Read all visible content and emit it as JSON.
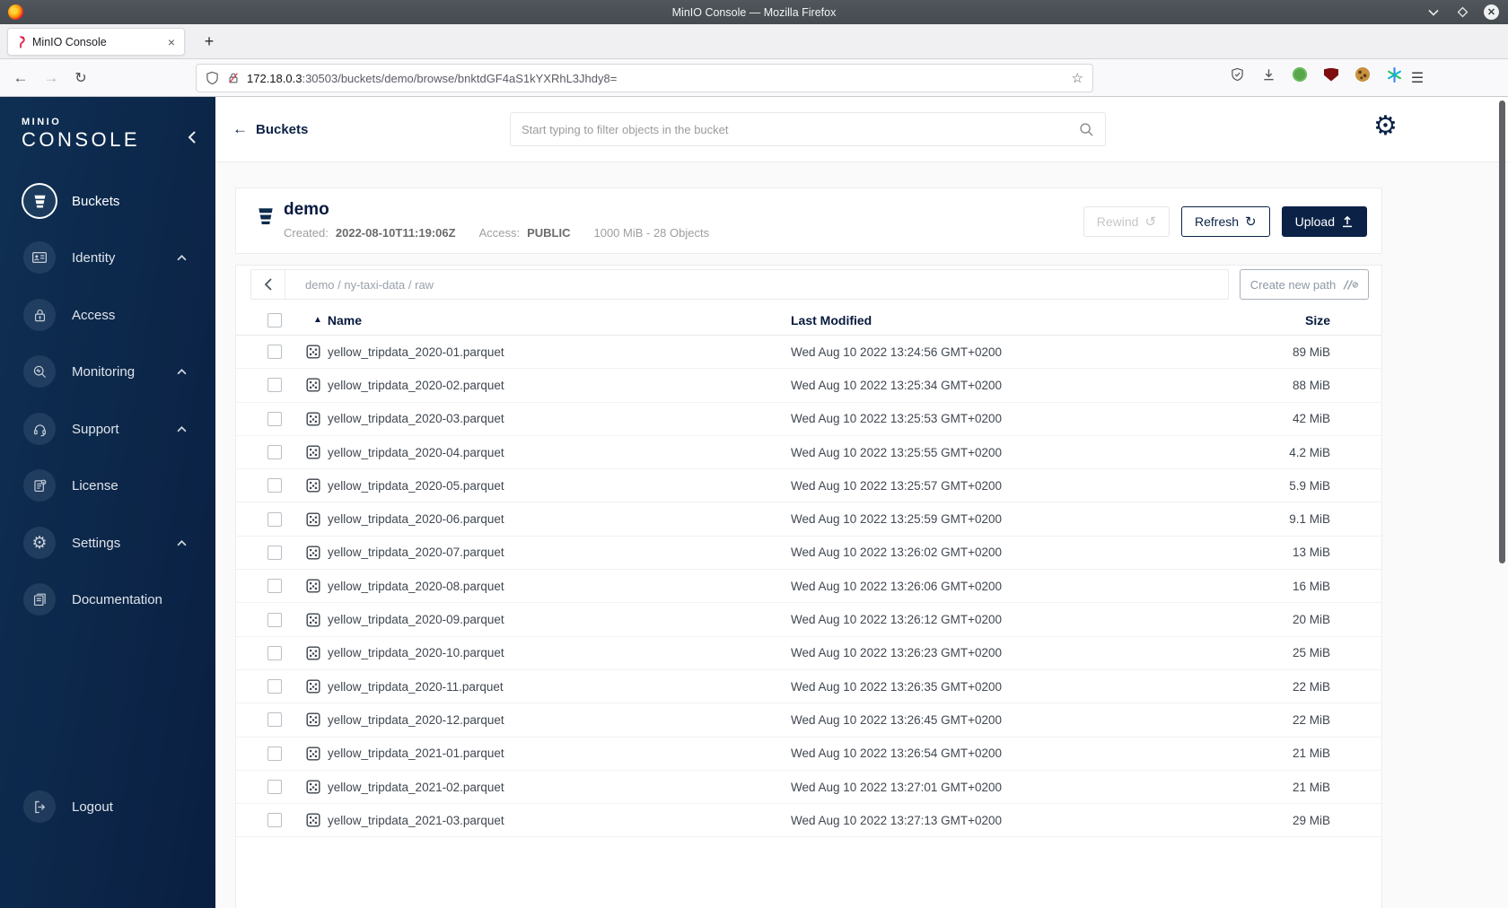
{
  "window": {
    "title": "MinIO Console — Mozilla Firefox",
    "minimize_glyph": "⌄",
    "close_glyph": "✕"
  },
  "tabbar": {
    "tab_title": "MinIO Console",
    "close_glyph": "×",
    "new_tab_glyph": "+"
  },
  "toolbar": {
    "back_glyph": "←",
    "forward_glyph": "→",
    "reload_glyph": "↻",
    "url_host": "172.18.0.3",
    "url_rest": ":30503/buckets/demo/browse/bnktdGF4aS1kYXRhL3Jhdy8=",
    "star_glyph": "☆",
    "menu_glyph": "☰"
  },
  "sidebar": {
    "logo_line1": "MINIO",
    "logo_line2": "CONSOLE",
    "items": [
      {
        "label": "Buckets",
        "active": true,
        "expandable": false
      },
      {
        "label": "Identity",
        "active": false,
        "expandable": true
      },
      {
        "label": "Access",
        "active": false,
        "expandable": false
      },
      {
        "label": "Monitoring",
        "active": false,
        "expandable": true
      },
      {
        "label": "Support",
        "active": false,
        "expandable": true
      },
      {
        "label": "License",
        "active": false,
        "expandable": false
      },
      {
        "label": "Settings",
        "active": false,
        "expandable": true
      },
      {
        "label": "Documentation",
        "active": false,
        "expandable": false
      }
    ],
    "settings_gear_glyph": "⚙",
    "logout_label": "Logout"
  },
  "page_header": {
    "back_glyph": "←",
    "back_label": "Buckets",
    "search_placeholder": "Start typing to filter objects in the bucket",
    "settings_gear_glyph": "⚙"
  },
  "bucket": {
    "name": "demo",
    "created_label": "Created:",
    "created_value": "2022-08-10T11:19:06Z",
    "access_label": "Access:",
    "access_value": "PUBLIC",
    "usage": "1000 MiB - 28 Objects",
    "rewind_label": "Rewind",
    "rewind_glyph": "↺",
    "refresh_label": "Refresh",
    "refresh_glyph": "↻",
    "upload_label": "Upload"
  },
  "browse": {
    "breadcrumb": "demo / ny-taxi-data / raw",
    "create_path_label": "Create new path"
  },
  "table": {
    "sort_glyph": "▲",
    "headers": {
      "name": "Name",
      "modified": "Last Modified",
      "size": "Size"
    },
    "rows": [
      {
        "name": "yellow_tripdata_2020-01.parquet",
        "modified": "Wed Aug 10 2022 13:24:56 GMT+0200",
        "size": "89 MiB"
      },
      {
        "name": "yellow_tripdata_2020-02.parquet",
        "modified": "Wed Aug 10 2022 13:25:34 GMT+0200",
        "size": "88 MiB"
      },
      {
        "name": "yellow_tripdata_2020-03.parquet",
        "modified": "Wed Aug 10 2022 13:25:53 GMT+0200",
        "size": "42 MiB"
      },
      {
        "name": "yellow_tripdata_2020-04.parquet",
        "modified": "Wed Aug 10 2022 13:25:55 GMT+0200",
        "size": "4.2 MiB"
      },
      {
        "name": "yellow_tripdata_2020-05.parquet",
        "modified": "Wed Aug 10 2022 13:25:57 GMT+0200",
        "size": "5.9 MiB"
      },
      {
        "name": "yellow_tripdata_2020-06.parquet",
        "modified": "Wed Aug 10 2022 13:25:59 GMT+0200",
        "size": "9.1 MiB"
      },
      {
        "name": "yellow_tripdata_2020-07.parquet",
        "modified": "Wed Aug 10 2022 13:26:02 GMT+0200",
        "size": "13 MiB"
      },
      {
        "name": "yellow_tripdata_2020-08.parquet",
        "modified": "Wed Aug 10 2022 13:26:06 GMT+0200",
        "size": "16 MiB"
      },
      {
        "name": "yellow_tripdata_2020-09.parquet",
        "modified": "Wed Aug 10 2022 13:26:12 GMT+0200",
        "size": "20 MiB"
      },
      {
        "name": "yellow_tripdata_2020-10.parquet",
        "modified": "Wed Aug 10 2022 13:26:23 GMT+0200",
        "size": "25 MiB"
      },
      {
        "name": "yellow_tripdata_2020-11.parquet",
        "modified": "Wed Aug 10 2022 13:26:35 GMT+0200",
        "size": "22 MiB"
      },
      {
        "name": "yellow_tripdata_2020-12.parquet",
        "modified": "Wed Aug 10 2022 13:26:45 GMT+0200",
        "size": "22 MiB"
      },
      {
        "name": "yellow_tripdata_2021-01.parquet",
        "modified": "Wed Aug 10 2022 13:26:54 GMT+0200",
        "size": "21 MiB"
      },
      {
        "name": "yellow_tripdata_2021-02.parquet",
        "modified": "Wed Aug 10 2022 13:27:01 GMT+0200",
        "size": "21 MiB"
      },
      {
        "name": "yellow_tripdata_2021-03.parquet",
        "modified": "Wed Aug 10 2022 13:27:13 GMT+0200",
        "size": "29 MiB"
      }
    ]
  },
  "colors": {
    "accent_navy": "#0b2246",
    "sidebar_gradient_start": "#0e2f53",
    "sidebar_gradient_end": "#0a1f41",
    "content_bg": "#fafafa"
  }
}
